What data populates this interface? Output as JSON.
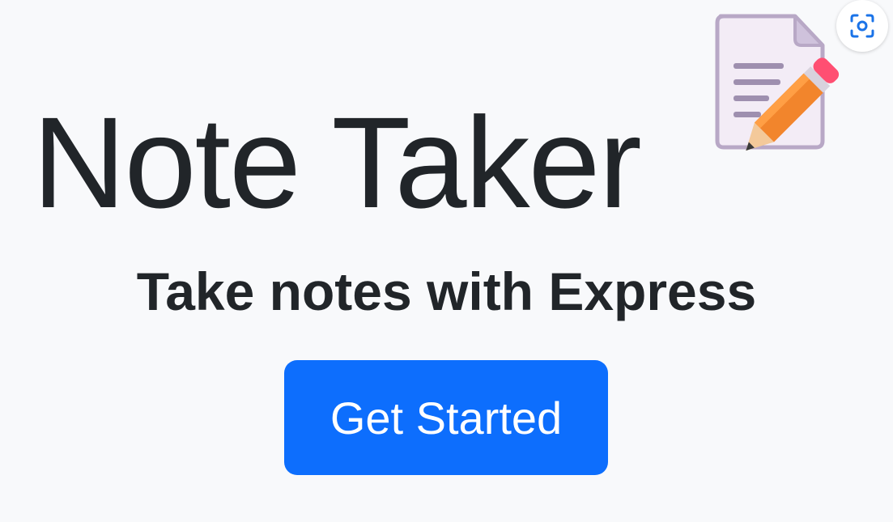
{
  "header": {
    "title": "Note Taker",
    "title_icon": "memo-icon"
  },
  "main": {
    "subtitle": "Take notes with Express",
    "cta_label": "Get Started"
  },
  "overlay": {
    "lens_icon": "visual-search-icon"
  },
  "colors": {
    "background": "#f8f9fb",
    "text": "#212529",
    "button": "#0d6efd",
    "button_text": "#ffffff",
    "lens_icon": "#1a73e8"
  }
}
